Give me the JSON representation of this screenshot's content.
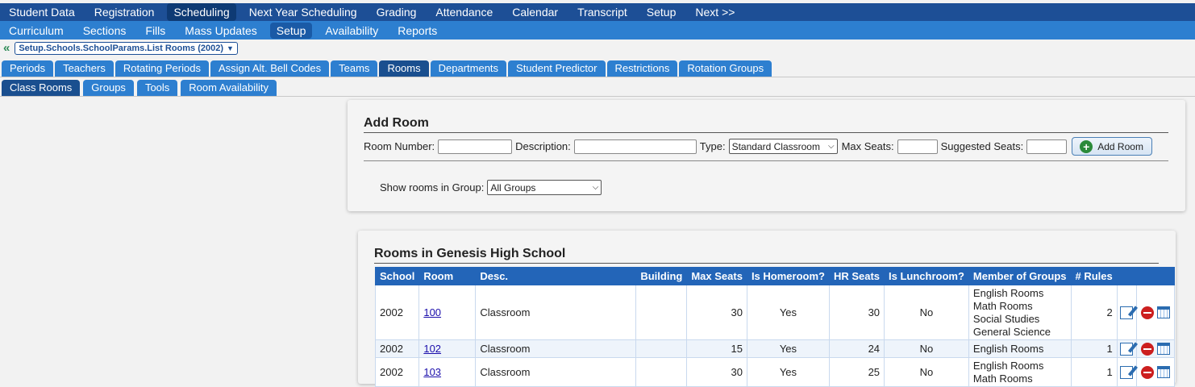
{
  "top_nav": [
    "Student Data",
    "Registration",
    "Scheduling",
    "Next Year Scheduling",
    "Grading",
    "Attendance",
    "Calendar",
    "Transcript",
    "Setup",
    "Next >>"
  ],
  "sub_nav": [
    "Curriculum",
    "Sections",
    "Fills",
    "Mass Updates",
    "Setup",
    "Availability",
    "Reports"
  ],
  "breadcrumb": {
    "back_icon": "double-chevron-left",
    "label": "Setup.Schools.SchoolParams.List Rooms (2002)"
  },
  "tabs_primary": [
    "Periods",
    "Teachers",
    "Rotating Periods",
    "Assign Alt. Bell Codes",
    "Teams",
    "Rooms",
    "Departments",
    "Student Predictor",
    "Restrictions",
    "Rotation Groups"
  ],
  "tabs_secondary": [
    "Class Rooms",
    "Groups",
    "Tools",
    "Room Availability"
  ],
  "add_room": {
    "title": "Add Room",
    "room_number_label": "Room Number:",
    "description_label": "Description:",
    "type_label": "Type:",
    "type_value": "Standard Classroom",
    "max_seats_label": "Max Seats:",
    "suggested_seats_label": "Suggested Seats:",
    "add_button": "Add Room",
    "group_label": "Show rooms in Group:",
    "group_value": "All Groups"
  },
  "rooms": {
    "title": "Rooms in Genesis High School",
    "headers": {
      "school": "School",
      "room": "Room",
      "desc": "Desc.",
      "building": "Building",
      "max_seats": "Max Seats",
      "is_homeroom": "Is Homeroom?",
      "hr_seats": "HR Seats",
      "is_lunchroom": "Is Lunchroom?",
      "member_groups": "Member of Groups",
      "rules": "# Rules"
    },
    "rows": [
      {
        "school": "2002",
        "room": "100",
        "desc": "Classroom",
        "building": "",
        "max_seats": "30",
        "is_homeroom": "Yes",
        "hr_seats": "30",
        "is_lunchroom": "No",
        "groups": [
          "English Rooms",
          "Math Rooms",
          "Social Studies",
          "General Science"
        ],
        "rules": "2"
      },
      {
        "school": "2002",
        "room": "102",
        "desc": "Classroom",
        "building": "",
        "max_seats": "15",
        "is_homeroom": "Yes",
        "hr_seats": "24",
        "is_lunchroom": "No",
        "groups": [
          "English Rooms"
        ],
        "rules": "1"
      },
      {
        "school": "2002",
        "room": "103",
        "desc": "Classroom",
        "building": "",
        "max_seats": "30",
        "is_homeroom": "Yes",
        "hr_seats": "25",
        "is_lunchroom": "No",
        "groups": [
          "English Rooms",
          "Math Rooms"
        ],
        "rules": "1"
      }
    ]
  },
  "colors": {
    "nav_dark": "#1d4f96",
    "nav_light": "#2d7fd0",
    "table_header": "#2365b8"
  }
}
